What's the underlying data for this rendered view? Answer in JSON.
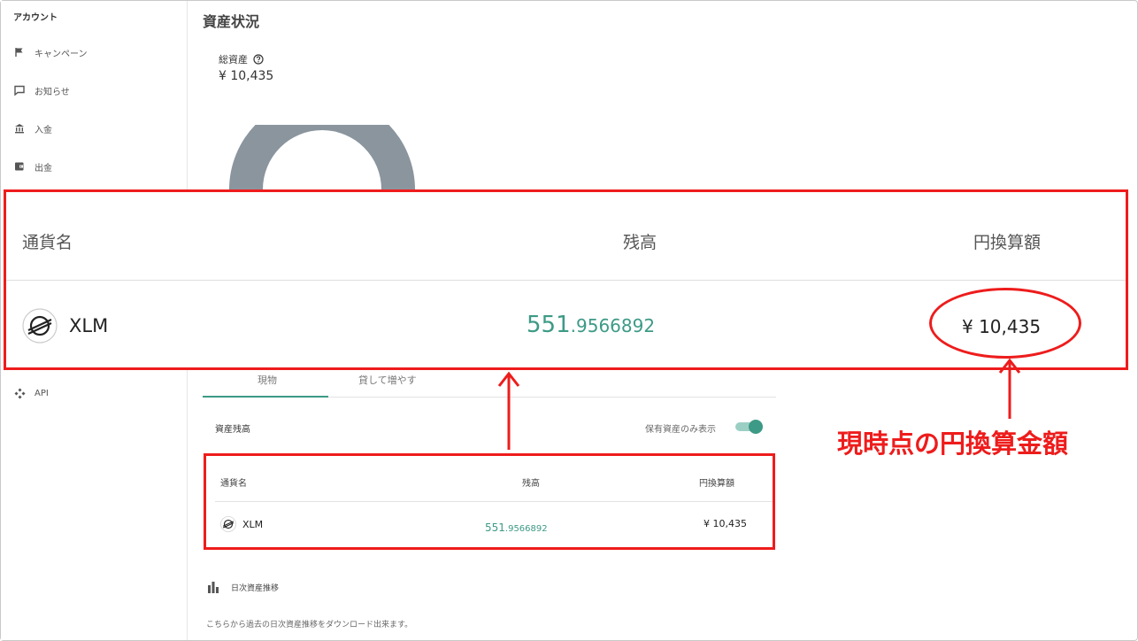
{
  "sidebar": {
    "heading": "アカウント",
    "items": [
      {
        "label": "キャンペーン",
        "icon": "flag-icon"
      },
      {
        "label": "お知らせ",
        "icon": "message-icon"
      },
      {
        "label": "入金",
        "icon": "bank-icon"
      },
      {
        "label": "出金",
        "icon": "wallet-icon"
      },
      {
        "label": "API",
        "icon": "api-icon"
      }
    ]
  },
  "main": {
    "title": "資産状況",
    "total_label": "総資産",
    "total_value": "¥ 10,435",
    "tabs": [
      {
        "label": "現物"
      },
      {
        "label": "貸して増やす"
      }
    ],
    "holdings_title": "資産残高",
    "toggle_label": "保有資産のみ表示",
    "toggle_on": true,
    "table": {
      "headers": [
        "通貨名",
        "残高",
        "円換算額"
      ],
      "rows": [
        {
          "coin": "XLM",
          "balance_int": "551",
          "balance_dec": ".9566892",
          "jpy": "¥ 10,435"
        }
      ]
    },
    "chart_link": "日次資産推移",
    "note": "こちらから過去の日次資産推移をダウンロード出来ます。"
  },
  "callout": {
    "text": "現時点の円換算金額",
    "color": "#ee1c1c"
  },
  "colors": {
    "accent": "#3d9a86",
    "donut": "#8a959e"
  }
}
